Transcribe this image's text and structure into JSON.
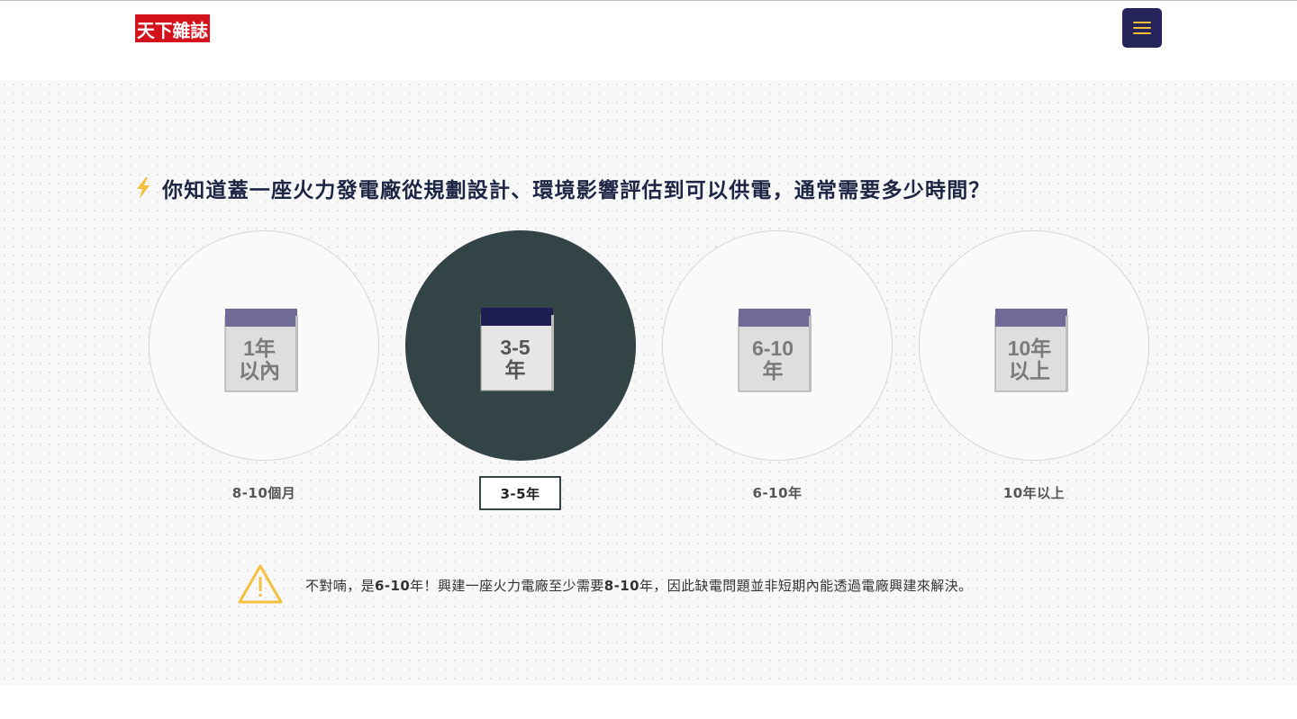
{
  "header": {
    "logo_text": "天下雜誌",
    "menu_icon": "hamburger-icon"
  },
  "colors": {
    "navy": "#25255c",
    "menu_bar": "#f4bd36",
    "selected_circle": "#334447",
    "question_text": "#1c2544",
    "calendar_top": "#6f6a96",
    "calendar_top_selected": "#1e1e52",
    "warning": "#f4c040",
    "bolt": "#f4c040"
  },
  "quiz": {
    "question_icon": "lightning-bolt-icon",
    "question": "你知道蓋一座火力發電廠從規劃設計、環境影響評估到可以供電，通常需要多少時間？",
    "selected_index": 1,
    "options": [
      {
        "icon_line1": "1年",
        "icon_line2": "以內",
        "label": "8-10個月"
      },
      {
        "icon_line1": "3-5",
        "icon_line2": "年",
        "label": "3-5年"
      },
      {
        "icon_line1": "6-10",
        "icon_line2": "年",
        "label": "6-10年"
      },
      {
        "icon_line1": "10年",
        "icon_line2": "以上",
        "label": "10年以上"
      }
    ]
  },
  "feedback": {
    "icon": "warning-triangle-icon",
    "text_1": "不對喃，是",
    "bold_1": "6-10",
    "text_2": "年！興建一座火力電廠至少需要",
    "bold_2": "8-10",
    "text_3": "年，因此缺電問題並非短期內能透過電廠興建來解決。"
  }
}
